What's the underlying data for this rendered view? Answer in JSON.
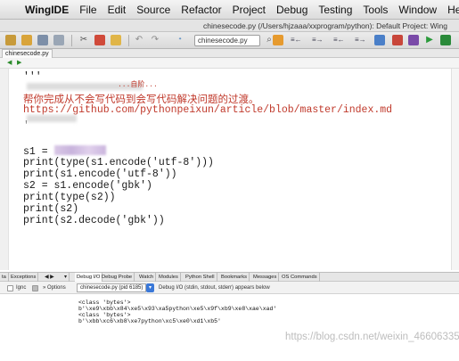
{
  "menubar": {
    "items": [
      "WingIDE",
      "File",
      "Edit",
      "Source",
      "Refactor",
      "Project",
      "Debug",
      "Testing",
      "Tools",
      "Window",
      "Help"
    ]
  },
  "window": {
    "title": "chinesecode.py (/Users/hjzaaa/xxprogram/python): Default Project: Wing"
  },
  "toolbar": {
    "search_value": "chinesecode.py"
  },
  "file_tab": {
    "label": "chinesecode.py"
  },
  "editor": {
    "docstring_open": "'''",
    "partial_line": "...自阶...",
    "comment_line": "帮你完成从不会写代码到会写代码解决问题的过渡。",
    "url_line": "https://github.com/pythonpeixun/article/blob/master/index.md",
    "docstring_close": "'",
    "code": [
      "s1 = ",
      "print(type(s1.encode('utf-8')))",
      "print(s1.encode('utf-8'))",
      "s2 = s1.encode('gbk')",
      "print(type(s2))",
      "print(s2)",
      "print(s2.decode('gbk'))"
    ]
  },
  "panel": {
    "tabs": [
      "ta",
      "Exceptions",
      "Debug I/O",
      "Debug Probe",
      "Watch",
      "Modules",
      "Python Shell",
      "Bookmarks",
      "Messages",
      "OS Commands"
    ],
    "ignore_label": "Ignc",
    "options_label": "Options",
    "process": "chinesecode.py (pid 6185)",
    "status": "Debug I/O (stdin, stdout, stderr) appears below",
    "output": [
      "<class 'bytes'>",
      "b'\\xe9\\xbb\\x84\\xe5\\x93\\xa5python\\xe5\\x9f\\xb9\\xe8\\xae\\xad'",
      "<class 'bytes'>",
      "b'\\xbb\\xc6\\xb8\\xe7python\\xc5\\xe0\\xd1\\xb5'"
    ]
  },
  "watermark": "https://blog.csdn.net/weixin_46606335"
}
